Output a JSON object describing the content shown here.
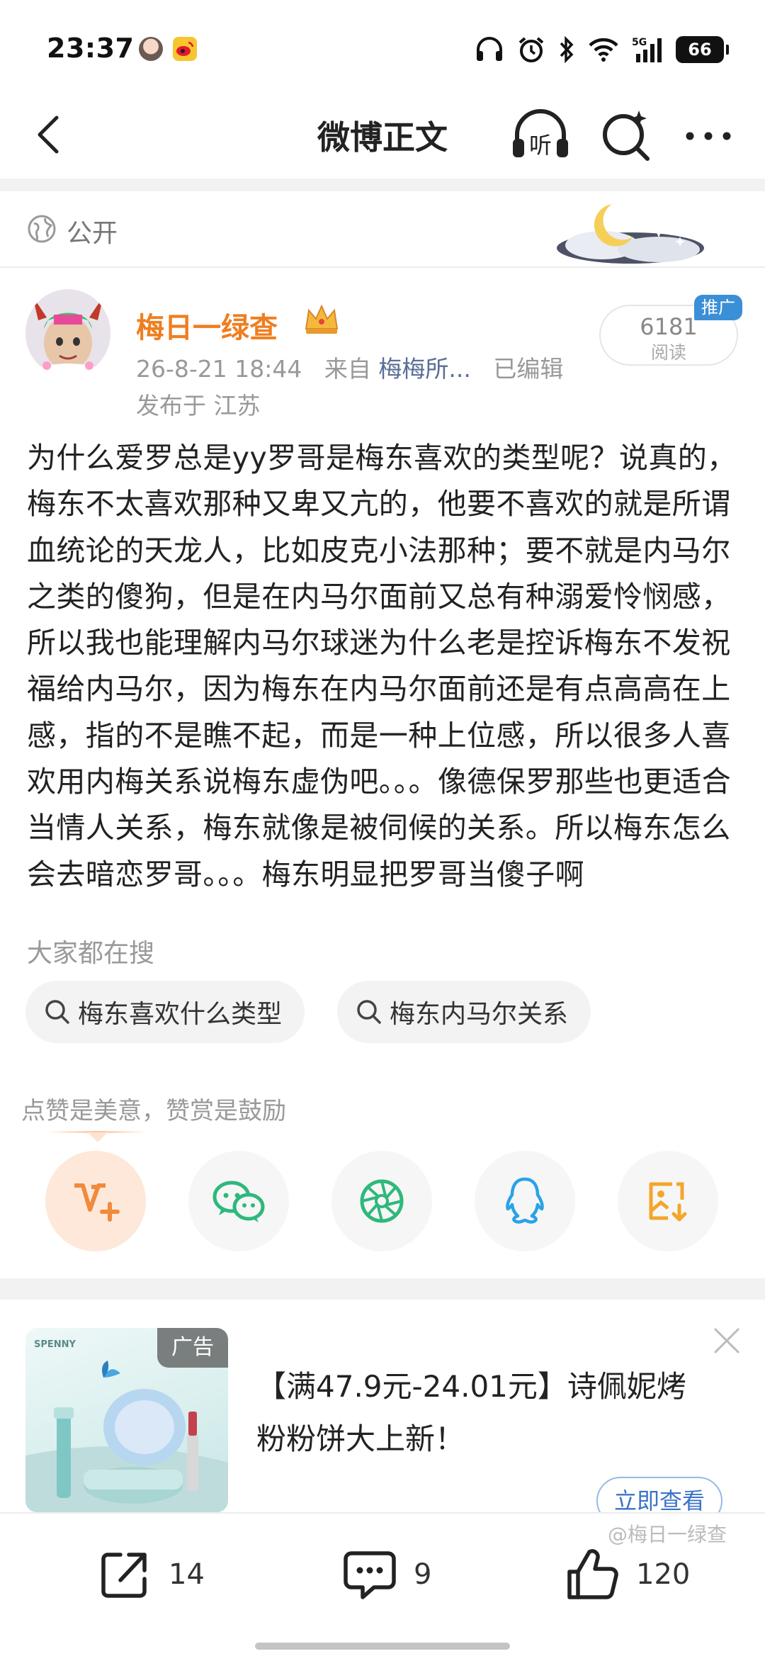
{
  "status_bar": {
    "time": "23:37",
    "battery": "66",
    "network": "5G"
  },
  "nav": {
    "title": "微博正文",
    "listen_label": "听"
  },
  "visibility": {
    "label": "公开"
  },
  "author": {
    "name": "梅日一绿查",
    "time": "26-8-21 18:44",
    "from_prefix": "来自",
    "source": "梅梅所...",
    "edited": "已编辑",
    "location": "发布于 江苏",
    "reads_count": "6181",
    "reads_label": "阅读",
    "promo_tag": "推广"
  },
  "post": {
    "text": "为什么爱罗总是yy罗哥是梅东喜欢的类型呢？说真的，梅东不太喜欢那种又卑又亢的，他要不喜欢的就是所谓血统论的天龙人，比如皮克小法那种；要不就是内马尔之类的傻狗，但是在内马尔面前又总有种溺爱怜悯感，所以我也能理解内马尔球迷为什么老是控诉梅东不发祝福给内马尔，因为梅东在内马尔面前还是有点高高在上感，指的不是瞧不起，而是一种上位感，所以很多人喜欢用内梅关系说梅东虚伪吧。。。像德保罗那些也更适合当情人关系，梅东就像是被伺候的关系。所以梅东怎么会去暗恋罗哥。。。梅东明显把罗哥当傻子啊"
  },
  "search": {
    "title": "大家都在搜",
    "chips": [
      "梅东喜欢什么类型",
      "梅东内马尔关系"
    ]
  },
  "reward": {
    "text": "点赞是美意，赞赏是鼓励"
  },
  "share_buttons": [
    {
      "name": "reward-button",
      "icon": "v-plus-icon"
    },
    {
      "name": "wechat-button",
      "icon": "wechat-icon"
    },
    {
      "name": "moments-button",
      "icon": "moments-icon"
    },
    {
      "name": "qq-button",
      "icon": "qq-icon"
    },
    {
      "name": "save-image-button",
      "icon": "image-download-icon"
    }
  ],
  "ad": {
    "tag": "广告",
    "brand": "SPENNY",
    "text": "【满47.9元-24.01元】诗佩妮烤粉粉饼大上新！",
    "button": "立即查看"
  },
  "bottom_bar": {
    "repost_count": "14",
    "comment_count": "9",
    "like_count": "120"
  },
  "watermark": "@梅日一绿查",
  "colors": {
    "author_name": "#ef7e20",
    "promo_tag": "#3b8fd6",
    "link": "#5a6e96",
    "ad_button": "#3b73c8",
    "reward_accent": "#f08a3c"
  }
}
